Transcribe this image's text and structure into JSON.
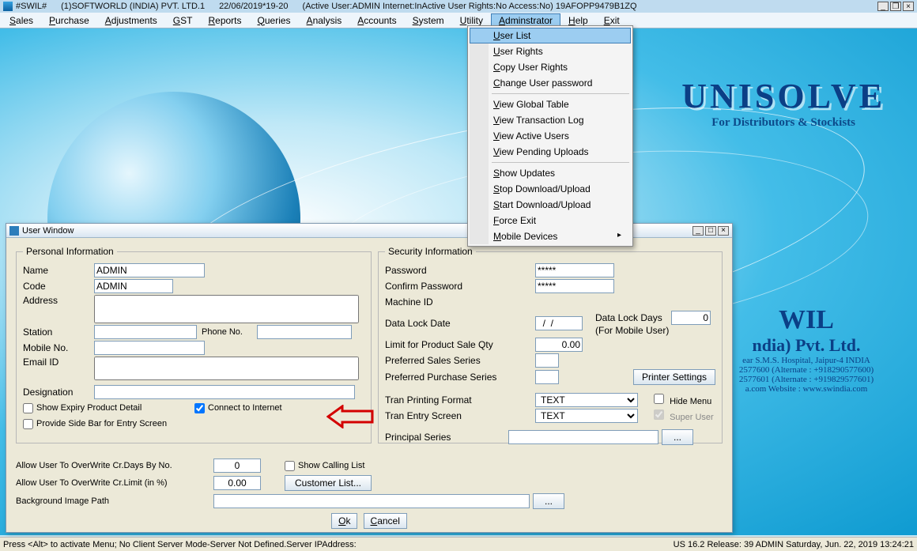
{
  "title": {
    "app": "#SWIL#",
    "company": "(1)SOFTWORLD (INDIA) PVT. LTD.1",
    "date": "22/06/2019*19-20",
    "info": "(Active User:ADMIN Internet:InActive User Rights:No Access:No) 19AFOPP9479B1ZQ"
  },
  "menu": [
    "Sales",
    "Purchase",
    "Adjustments",
    "GST",
    "Reports",
    "Queries",
    "Analysis",
    "Accounts",
    "System",
    "Utility",
    "Adminstrator",
    "Help",
    "Exit"
  ],
  "menu_hl_index": 10,
  "dropdown": [
    {
      "t": "item",
      "label": "User List",
      "hl": true
    },
    {
      "t": "item",
      "label": "User Rights"
    },
    {
      "t": "item",
      "label": "Copy User Rights"
    },
    {
      "t": "item",
      "label": "Change User password"
    },
    {
      "t": "sep"
    },
    {
      "t": "item",
      "label": "View Global Table"
    },
    {
      "t": "item",
      "label": "View Transaction Log"
    },
    {
      "t": "item",
      "label": "View Active Users"
    },
    {
      "t": "item",
      "label": "View Pending Uploads"
    },
    {
      "t": "sep"
    },
    {
      "t": "item",
      "label": "Show Updates"
    },
    {
      "t": "item",
      "label": "Stop Download/Upload"
    },
    {
      "t": "item",
      "label": "Start Download/Upload"
    },
    {
      "t": "item",
      "label": "Force Exit"
    },
    {
      "t": "item",
      "label": "Mobile Devices",
      "sub": true
    }
  ],
  "brand": {
    "name": "UNISOLVE",
    "sub": "For Distributors & Stockists"
  },
  "rightlogo": {
    "big": "WIL",
    "co": "ndia) Pvt. Ltd.",
    "l1": "ear S.M.S. Hospital, Jaipur-4 INDIA",
    "l2": "2577600 (Alternate : +918290577600)",
    "l3": "2577601 (Alternate : +919829577601)",
    "l4": "a.com   Website : www.swindia.com"
  },
  "userwin": {
    "title": "User Window",
    "personal": {
      "legend": "Personal Information",
      "name_lbl": "Name",
      "name_val": "ADMIN",
      "code_lbl": "Code",
      "code_val": "ADMIN",
      "addr_lbl": "Address",
      "addr_val": "",
      "station_lbl": "Station",
      "station_val": "",
      "phone_lbl": "Phone No.",
      "phone_val": "",
      "mobile_lbl": "Mobile No.",
      "mobile_val": "",
      "email_lbl": "Email ID",
      "email_val": "",
      "desig_lbl": "Designation",
      "desig_val": "",
      "chk_expiry": "Show Expiry Product Detail",
      "chk_internet": "Connect to Internet",
      "chk_sidebar": "Provide Side Bar for Entry Screen"
    },
    "security": {
      "legend": "Security Information",
      "pwd_lbl": "Password",
      "pwd_val": "*****",
      "cpwd_lbl": "Confirm Password",
      "cpwd_val": "*****",
      "mid_lbl": "Machine ID",
      "mid_val": "",
      "dld_lbl": "Data Lock Date",
      "dld_val": "  /  /",
      "dldays_lbl": "Data Lock Days",
      "dldays_val": "0",
      "dldays_sub": "(For Mobile User)",
      "limit_lbl": "Limit for Product Sale Qty",
      "limit_val": "0.00",
      "pss_lbl": "Preferred Sales Series",
      "pss_val": "",
      "pps_lbl": "Preferred Purchase Series",
      "pps_val": "",
      "printer_btn": "Printer Settings",
      "tpf_lbl": "Tran Printing Format",
      "tpf_val": "TEXT",
      "tes_lbl": "Tran Entry Screen",
      "tes_val": "TEXT",
      "hide_lbl": "Hide Menu",
      "super_lbl": "Super User",
      "principal_lbl": "Principal Series",
      "principal_btn": "..."
    },
    "footer": {
      "a1_lbl": "Allow User To OverWrite Cr.Days By No.",
      "a1_val": "0",
      "a2_lbl": "Allow User To OverWrite Cr.Limit (in %)",
      "a2_val": "0.00",
      "bg_lbl": "Background Image Path",
      "bg_btn": "...",
      "chk_call": "Show Calling List",
      "cust_btn": "Customer List...",
      "ok": "Ok",
      "cancel": "Cancel"
    }
  },
  "status": {
    "left": "Press <Alt> to activate Menu; No Client Server Mode-Server Not Defined.Server IPAddress:",
    "right": "US 16.2 Release: 39  ADMIN  Saturday, Jun. 22, 2019  13:24:21"
  }
}
